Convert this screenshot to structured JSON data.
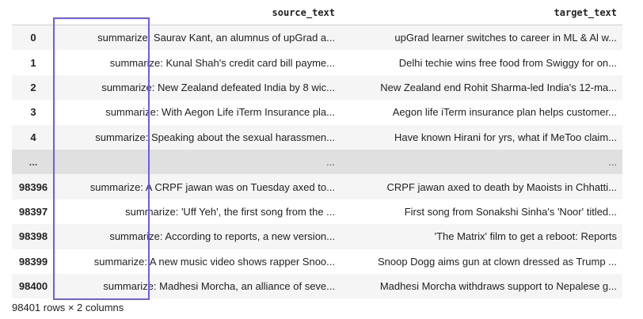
{
  "columns": [
    "source_text",
    "target_text"
  ],
  "rows": [
    {
      "index": "0",
      "source_text": "summarize: Saurav Kant, an alumnus of upGrad a...",
      "target_text": "upGrad learner switches to career in ML & Al w..."
    },
    {
      "index": "1",
      "source_text": "summarize: Kunal Shah's credit card bill payme...",
      "target_text": "Delhi techie wins free food from Swiggy for on..."
    },
    {
      "index": "2",
      "source_text": "summarize: New Zealand defeated India by 8 wic...",
      "target_text": "New Zealand end Rohit Sharma-led India's 12-ma..."
    },
    {
      "index": "3",
      "source_text": "summarize: With Aegon Life iTerm Insurance pla...",
      "target_text": "Aegon life iTerm insurance plan helps customer..."
    },
    {
      "index": "4",
      "source_text": "summarize: Speaking about the sexual harassmen...",
      "target_text": "Have known Hirani for yrs, what if MeToo claim..."
    },
    {
      "index": "...",
      "source_text": "...",
      "target_text": "..."
    },
    {
      "index": "98396",
      "source_text": "summarize: A CRPF jawan was on Tuesday axed to...",
      "target_text": "CRPF jawan axed to death by Maoists in Chhatti..."
    },
    {
      "index": "98397",
      "source_text": "summarize: 'Uff Yeh', the first song from the ...",
      "target_text": "First song from Sonakshi Sinha's 'Noor' titled..."
    },
    {
      "index": "98398",
      "source_text": "summarize: According to reports, a new version...",
      "target_text": "'The Matrix' film to get a reboot: Reports"
    },
    {
      "index": "98399",
      "source_text": "summarize: A new music video shows rapper Snoo...",
      "target_text": "Snoop Dogg aims gun at clown dressed as Trump ..."
    },
    {
      "index": "98400",
      "source_text": "summarize: Madhesi Morcha, an alliance of seve...",
      "target_text": "Madhesi Morcha withdraws support to Nepalese g..."
    }
  ],
  "footer": "98401 rows × 2 columns",
  "colors": {
    "highlight": "#6b5cf0",
    "stripe": "#f5f5f5",
    "ellipsis_row": "#e0e0e0"
  }
}
